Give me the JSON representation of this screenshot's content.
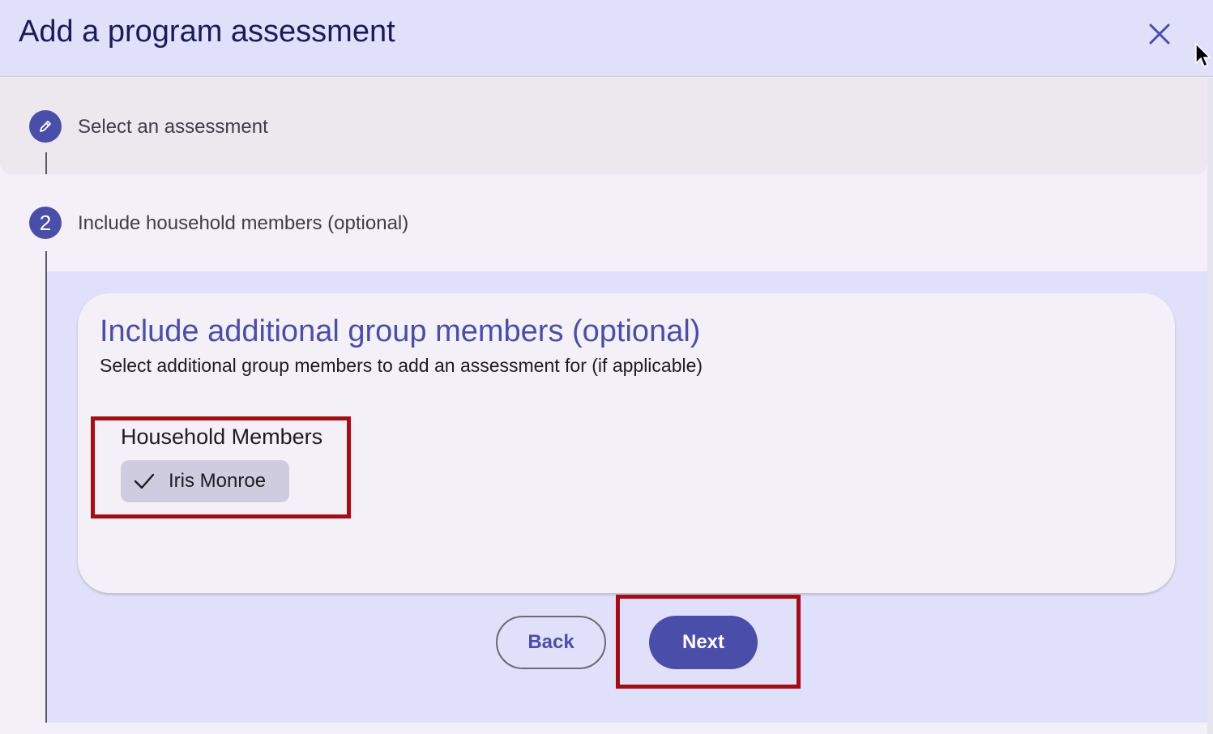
{
  "dialog": {
    "title": "Add a program assessment"
  },
  "steps": [
    {
      "number": "",
      "icon": "pencil-icon",
      "label": "Select an assessment",
      "state": "completed"
    },
    {
      "number": "2",
      "label": "Include household members (optional)",
      "state": "active"
    }
  ],
  "card": {
    "title": "Include additional group members (optional)",
    "subtitle": "Select additional group members to add an assessment for (if applicable)",
    "group_label": "Household Members",
    "members": [
      {
        "name": "Iris Monroe",
        "selected": true
      }
    ]
  },
  "buttons": {
    "back": "Back",
    "next": "Next"
  },
  "colors": {
    "accent": "#4b4ea8",
    "header_bg": "#e0e0fa",
    "highlight": "#a50d15"
  }
}
